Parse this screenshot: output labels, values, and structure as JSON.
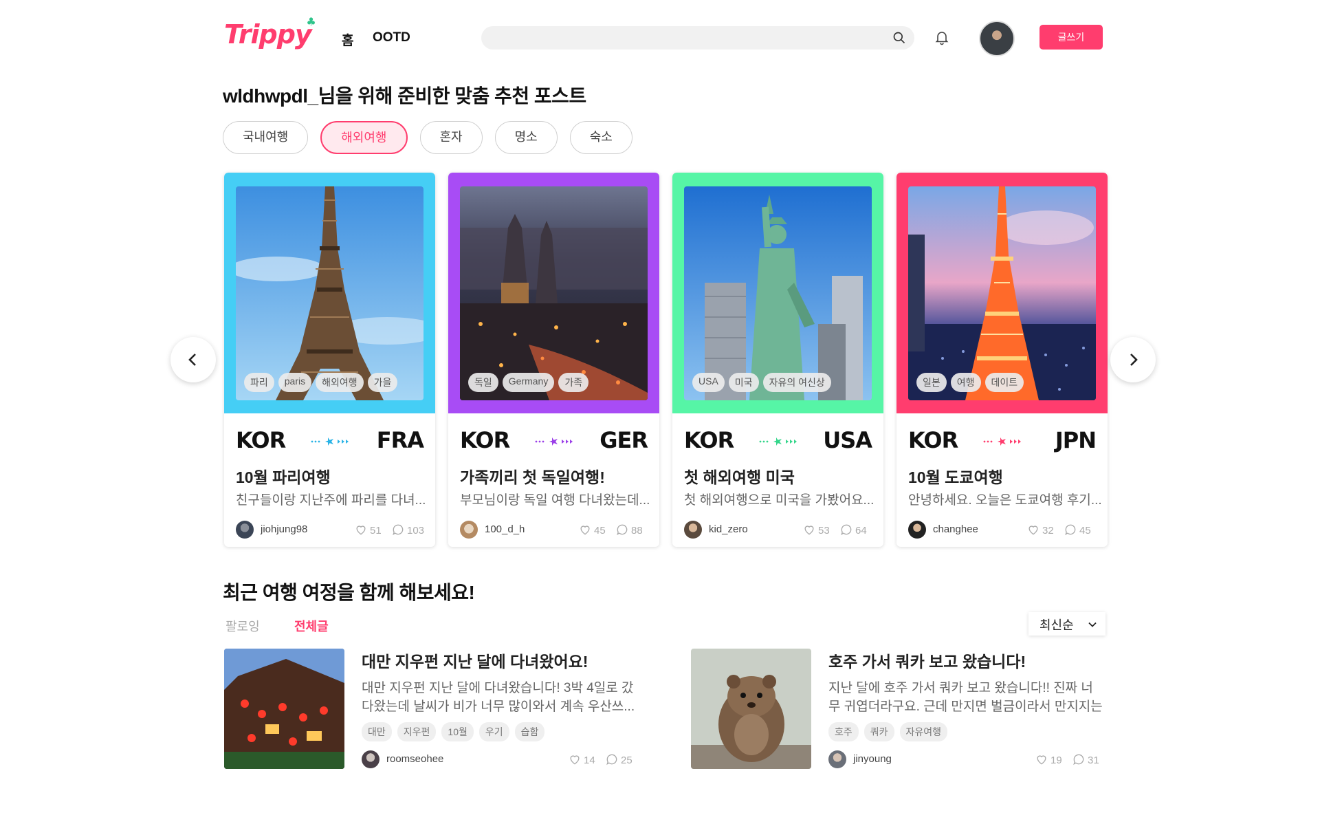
{
  "header": {
    "logo": "Trippy",
    "nav": [
      "홈",
      "OOTD"
    ],
    "search": {
      "placeholder": "",
      "value": ""
    },
    "write_label": "글쓰기"
  },
  "recommend": {
    "title": "wldhwpdl_님을 위해 준비한 맞춤 추천 포스트",
    "chips": [
      "국내여행",
      "해외여행",
      "혼자",
      "명소",
      "숙소"
    ],
    "active_chip": "해외여행",
    "cards": [
      {
        "color": "#45cef5",
        "tags": [
          "파리",
          "paris",
          "해외여행",
          "가을"
        ],
        "from": "KOR",
        "to": "FRA",
        "plane_color": "#29b3e6",
        "title": "10월 파리여행",
        "desc": "친구들이랑 지난주에 파리를 다녀...",
        "user": "jiohjung98",
        "likes": "51",
        "comments": "103"
      },
      {
        "color": "#a84cf5",
        "tags": [
          "독일",
          "Germany",
          "가족"
        ],
        "from": "KOR",
        "to": "GER",
        "plane_color": "#9b3fe8",
        "title": "가족끼리 첫 독일여행!",
        "desc": "부모님이랑 독일 여행 다녀왔는데...",
        "user": "100_d_h",
        "likes": "45",
        "comments": "88"
      },
      {
        "color": "#56f5a6",
        "tags": [
          "USA",
          "미국",
          "자유의 여신상"
        ],
        "from": "KOR",
        "to": "USA",
        "plane_color": "#35d68b",
        "title": "첫 해외여행 미국",
        "desc": "첫 해외여행으로 미국을 가봤어요...",
        "user": "kid_zero",
        "likes": "53",
        "comments": "64"
      },
      {
        "color": "#ff3d6e",
        "tags": [
          "일본",
          "여행",
          "데이트"
        ],
        "from": "KOR",
        "to": "JPN",
        "plane_color": "#ff3d6e",
        "title": "10월 도쿄여행",
        "desc": "안녕하세요. 오늘은 도쿄여행 후기...",
        "user": "changhee",
        "likes": "32",
        "comments": "45"
      }
    ]
  },
  "recent": {
    "title": "최근 여행 여정을 함께 해보세요!",
    "tabs": [
      "팔로잉",
      "전체글"
    ],
    "active_tab": "전체글",
    "sort": "최신순",
    "posts": [
      {
        "title": "대만 지우펀 지난 달에 다녀왔어요!",
        "desc": "대만 지우펀 지난 달에 다녀왔습니다! 3박 4일로 갔다왔는데 날씨가 비가 너무 많이와서 계속 우산쓰...",
        "tags": [
          "대만",
          "지우펀",
          "10월",
          "우기",
          "습함"
        ],
        "user": "roomseohee",
        "likes": "14",
        "comments": "25"
      },
      {
        "title": "호주 가서 쿼카 보고 왔습니다!",
        "desc": "지난 달에 호주 가서 쿼카 보고 왔습니다!! 진짜 너무 귀엽더라구요. 근데 만지면 벌금이라서 만지지는 ...",
        "tags": [
          "호주",
          "쿼카",
          "자유여행"
        ],
        "user": "jinyoung",
        "likes": "19",
        "comments": "31"
      }
    ]
  }
}
